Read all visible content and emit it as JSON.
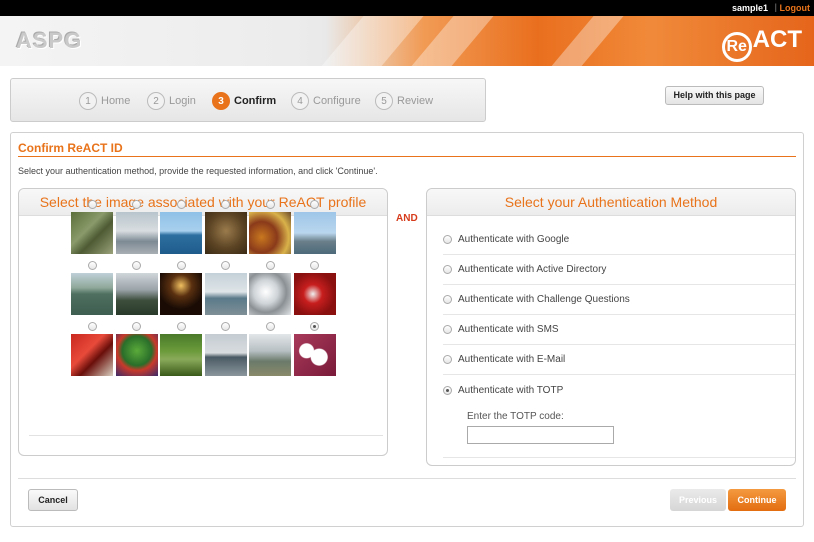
{
  "topbar": {
    "username": "sample1",
    "separator": "|",
    "logout": "Logout"
  },
  "banner": {
    "left_logo": "ASPG",
    "right_logo_circle": "Re",
    "right_logo_text": "ACT"
  },
  "wizard": {
    "steps": [
      {
        "num": "1",
        "label": "Home"
      },
      {
        "num": "2",
        "label": "Login"
      },
      {
        "num": "3",
        "label": "Confirm"
      },
      {
        "num": "4",
        "label": "Configure"
      },
      {
        "num": "5",
        "label": "Review"
      }
    ],
    "active_step": 3
  },
  "help_button": "Help with this page",
  "section": {
    "title": "Confirm ReACT ID",
    "instructions": "Select your authentication method, provide the requested information, and click 'Continue'."
  },
  "image_panel": {
    "title": "Select the image associated with your ReACT profile",
    "selected_index": 17,
    "images": [
      "lizard-photo",
      "seagulls-photo",
      "sea-ship-photo",
      "lion-statue-photo",
      "spices-photo",
      "tower-bridge-photo",
      "lake-photo",
      "city-skyline-photo",
      "sunset-reflection-photo",
      "lighthouse-photo",
      "car-headlight-photo",
      "red-car-photo",
      "fire-truck-photo",
      "turtle-toy-photo",
      "tree-path-photo",
      "lake-house-photo",
      "misty-mountains-photo",
      "dice-photo"
    ]
  },
  "and_label": "AND",
  "auth_panel": {
    "title": "Select your Authentication Method",
    "methods": [
      "Authenticate with Google",
      "Authenticate with Active Directory",
      "Authenticate with Challenge Questions",
      "Authenticate with SMS",
      "Authenticate with E-Mail",
      "Authenticate with TOTP"
    ],
    "selected_index": 5,
    "totp_label": "Enter the TOTP code:",
    "totp_value": ""
  },
  "buttons": {
    "cancel": "Cancel",
    "previous": "Previous",
    "continue": "Continue"
  },
  "colors": {
    "accent": "#e8731a",
    "and_red": "#d63c1c"
  }
}
